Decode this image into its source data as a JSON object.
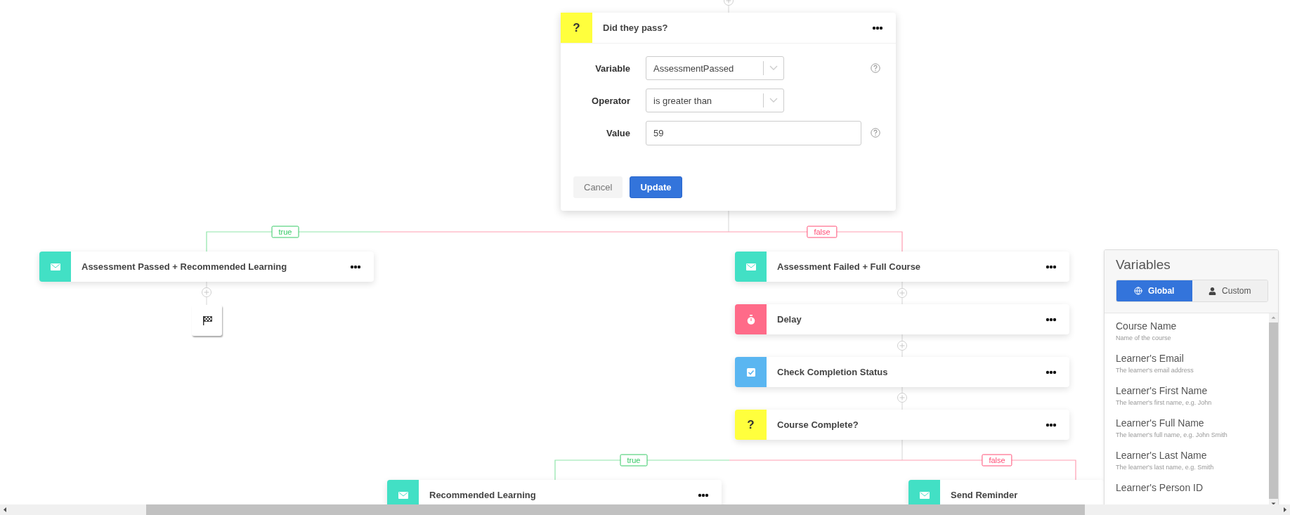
{
  "dialog": {
    "glyph": "?",
    "title": "Did they pass?",
    "fields": [
      {
        "label": "Variable",
        "kind": "select",
        "value": "AssessmentPassed",
        "help": true
      },
      {
        "label": "Operator",
        "kind": "select",
        "value": "is greater than",
        "help": false
      },
      {
        "label": "Value",
        "kind": "input",
        "value": "59",
        "help": true
      }
    ],
    "buttons": [
      {
        "label": "Cancel",
        "kind": "secondary"
      },
      {
        "label": "Update",
        "kind": "primary"
      }
    ]
  },
  "branch_labels": [
    {
      "kind": "true",
      "label": "true"
    },
    {
      "kind": "false",
      "label": "false"
    },
    {
      "kind": "true",
      "label": "true"
    },
    {
      "kind": "false",
      "label": "false"
    }
  ],
  "nodes": [
    {
      "kind": "email",
      "title": "Assessment Passed + Recommended Learning",
      "menu": true
    },
    {
      "kind": "email",
      "title": "Assessment Failed + Full Course",
      "menu": true
    },
    {
      "kind": "delay",
      "title": "Delay",
      "menu": true
    },
    {
      "kind": "check",
      "title": "Check Completion Status",
      "menu": true
    },
    {
      "kind": "condition",
      "glyph": "?",
      "title": "Course Complete?",
      "menu": true
    },
    {
      "kind": "email",
      "title": "Recommended Learning",
      "menu": true
    },
    {
      "kind": "email",
      "title": "Send Reminder",
      "menu": false
    }
  ],
  "variables_panel": {
    "title": "Variables",
    "tabs": [
      {
        "label": "Global",
        "kind": "global",
        "selected": true
      },
      {
        "label": "Custom",
        "kind": "custom",
        "selected": false
      }
    ],
    "items": [
      {
        "name": "Course Name",
        "description": "Name of the course"
      },
      {
        "name": "Learner's Email",
        "description": "The learner's email address"
      },
      {
        "name": "Learner's First Name",
        "description": "The learner's first name, e.g. John"
      },
      {
        "name": "Learner's Full Name",
        "description": "The learner's full name, e.g. John Smith"
      },
      {
        "name": "Learner's Last Name",
        "description": "The learner's last name, e.g. Smith"
      },
      {
        "name": "Learner's Person ID"
      }
    ]
  }
}
